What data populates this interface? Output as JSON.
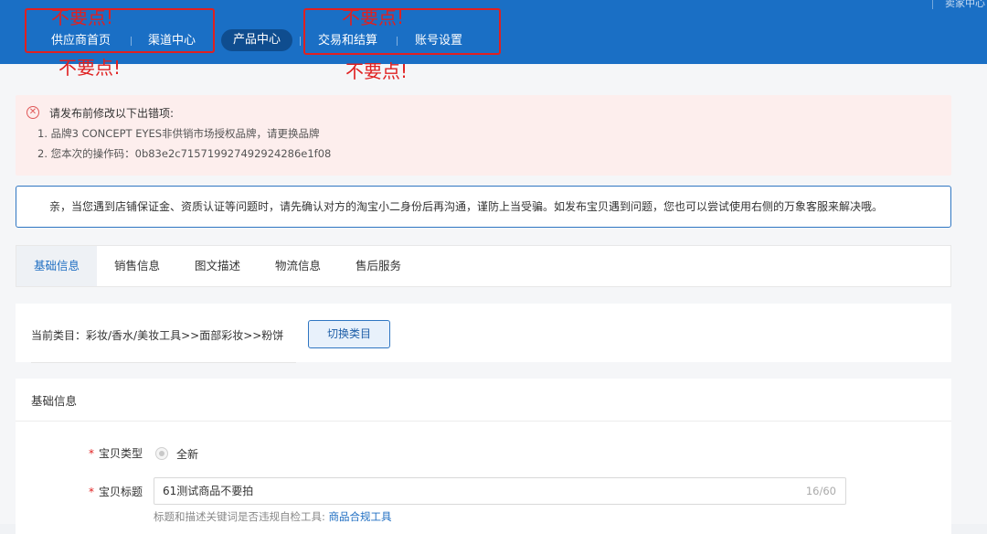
{
  "nav": {
    "items": [
      "供应商首页",
      "渠道中心",
      "产品中心",
      "交易和结算",
      "账号设置"
    ],
    "active": "产品中心",
    "seller_link": "卖家中心"
  },
  "annotations": {
    "warning": "不要点!"
  },
  "error": {
    "title": "请发布前修改以下出错项:",
    "items": [
      "1.  品牌3 CONCEPT EYES非供销市场授权品牌，请更换品牌",
      "2.  您本次的操作码：0b83e2c715719927492924286e1f08"
    ]
  },
  "tip": {
    "text": "亲，当您遇到店铺保证金、资质认证等问题时，请先确认对方的淘宝小二身份后再沟通，谨防上当受骗。如发布宝贝遇到问题，您也可以尝试使用右侧的万象客服来解决哦。"
  },
  "tabs": [
    "基础信息",
    "销售信息",
    "图文描述",
    "物流信息",
    "售后服务"
  ],
  "category": {
    "label": "当前类目：彩妆/香水/美妆工具>>面部彩妆>>粉饼",
    "switch_button": "切换类目"
  },
  "basic": {
    "section_title": "基础信息",
    "type_label": "宝贝类型",
    "type_value": "全新",
    "title_label": "宝贝标题",
    "title_value": "61测试商品不要拍",
    "title_count": "16/60",
    "helper_text": "标题和描述关键词是否违规自检工具:",
    "helper_link": "商品合规工具"
  },
  "colors": {
    "nav_bg": "#1a6fc5",
    "annotation": "#e02020",
    "accent": "#1f6ec2"
  }
}
